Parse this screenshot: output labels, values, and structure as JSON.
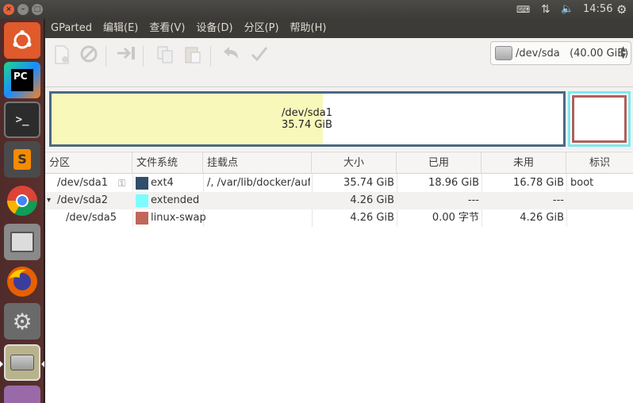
{
  "topbar": {
    "close": "×",
    "minimize": "–",
    "maximize": "□",
    "keyboard_icon": "keyboard-icon",
    "network_icon": "network-icon",
    "volume_icon": "volume-icon",
    "time": "14:56",
    "settings_icon": "gear-icon"
  },
  "launcher": {
    "items": [
      "ubuntu-dash",
      "pycharm",
      "terminal",
      "sublime-text",
      "chrome",
      "files",
      "firefox",
      "system-tools",
      "gparted",
      "app"
    ]
  },
  "menubar": {
    "items": [
      "GParted",
      "编辑(E)",
      "查看(V)",
      "设备(D)",
      "分区(P)",
      "帮助(H)"
    ]
  },
  "toolbar": {
    "device": "/dev/sda   (40.00 GiB)"
  },
  "map": {
    "seg1_name": "/dev/sda1",
    "seg1_size": "35.74 GiB",
    "seg1_used_fraction": 0.53
  },
  "table": {
    "headers": [
      "分区",
      "文件系统",
      "挂载点",
      "大小",
      "已用",
      "未用",
      "标识"
    ],
    "rows": [
      {
        "expander": "",
        "partition": "/dev/sda1",
        "fs": "ext4",
        "fs_color": "#314e6c",
        "mount": "/, /var/lib/docker/aufs",
        "size": "35.74 GiB",
        "used": "18.96 GiB",
        "unused": "16.78 GiB",
        "flags": "boot"
      },
      {
        "expander": "▾",
        "partition": "/dev/sda2",
        "fs": "extended",
        "fs_color": "#7dfcfe",
        "mount": "",
        "size": "4.26 GiB",
        "used": "---",
        "unused": "---",
        "flags": ""
      },
      {
        "expander": "",
        "partition": "/dev/sda5",
        "fs": "linux-swap",
        "fs_color": "#c1665a",
        "mount": "",
        "size": "4.26 GiB",
        "used": "0.00 字节",
        "unused": "4.26 GiB",
        "flags": ""
      }
    ]
  }
}
